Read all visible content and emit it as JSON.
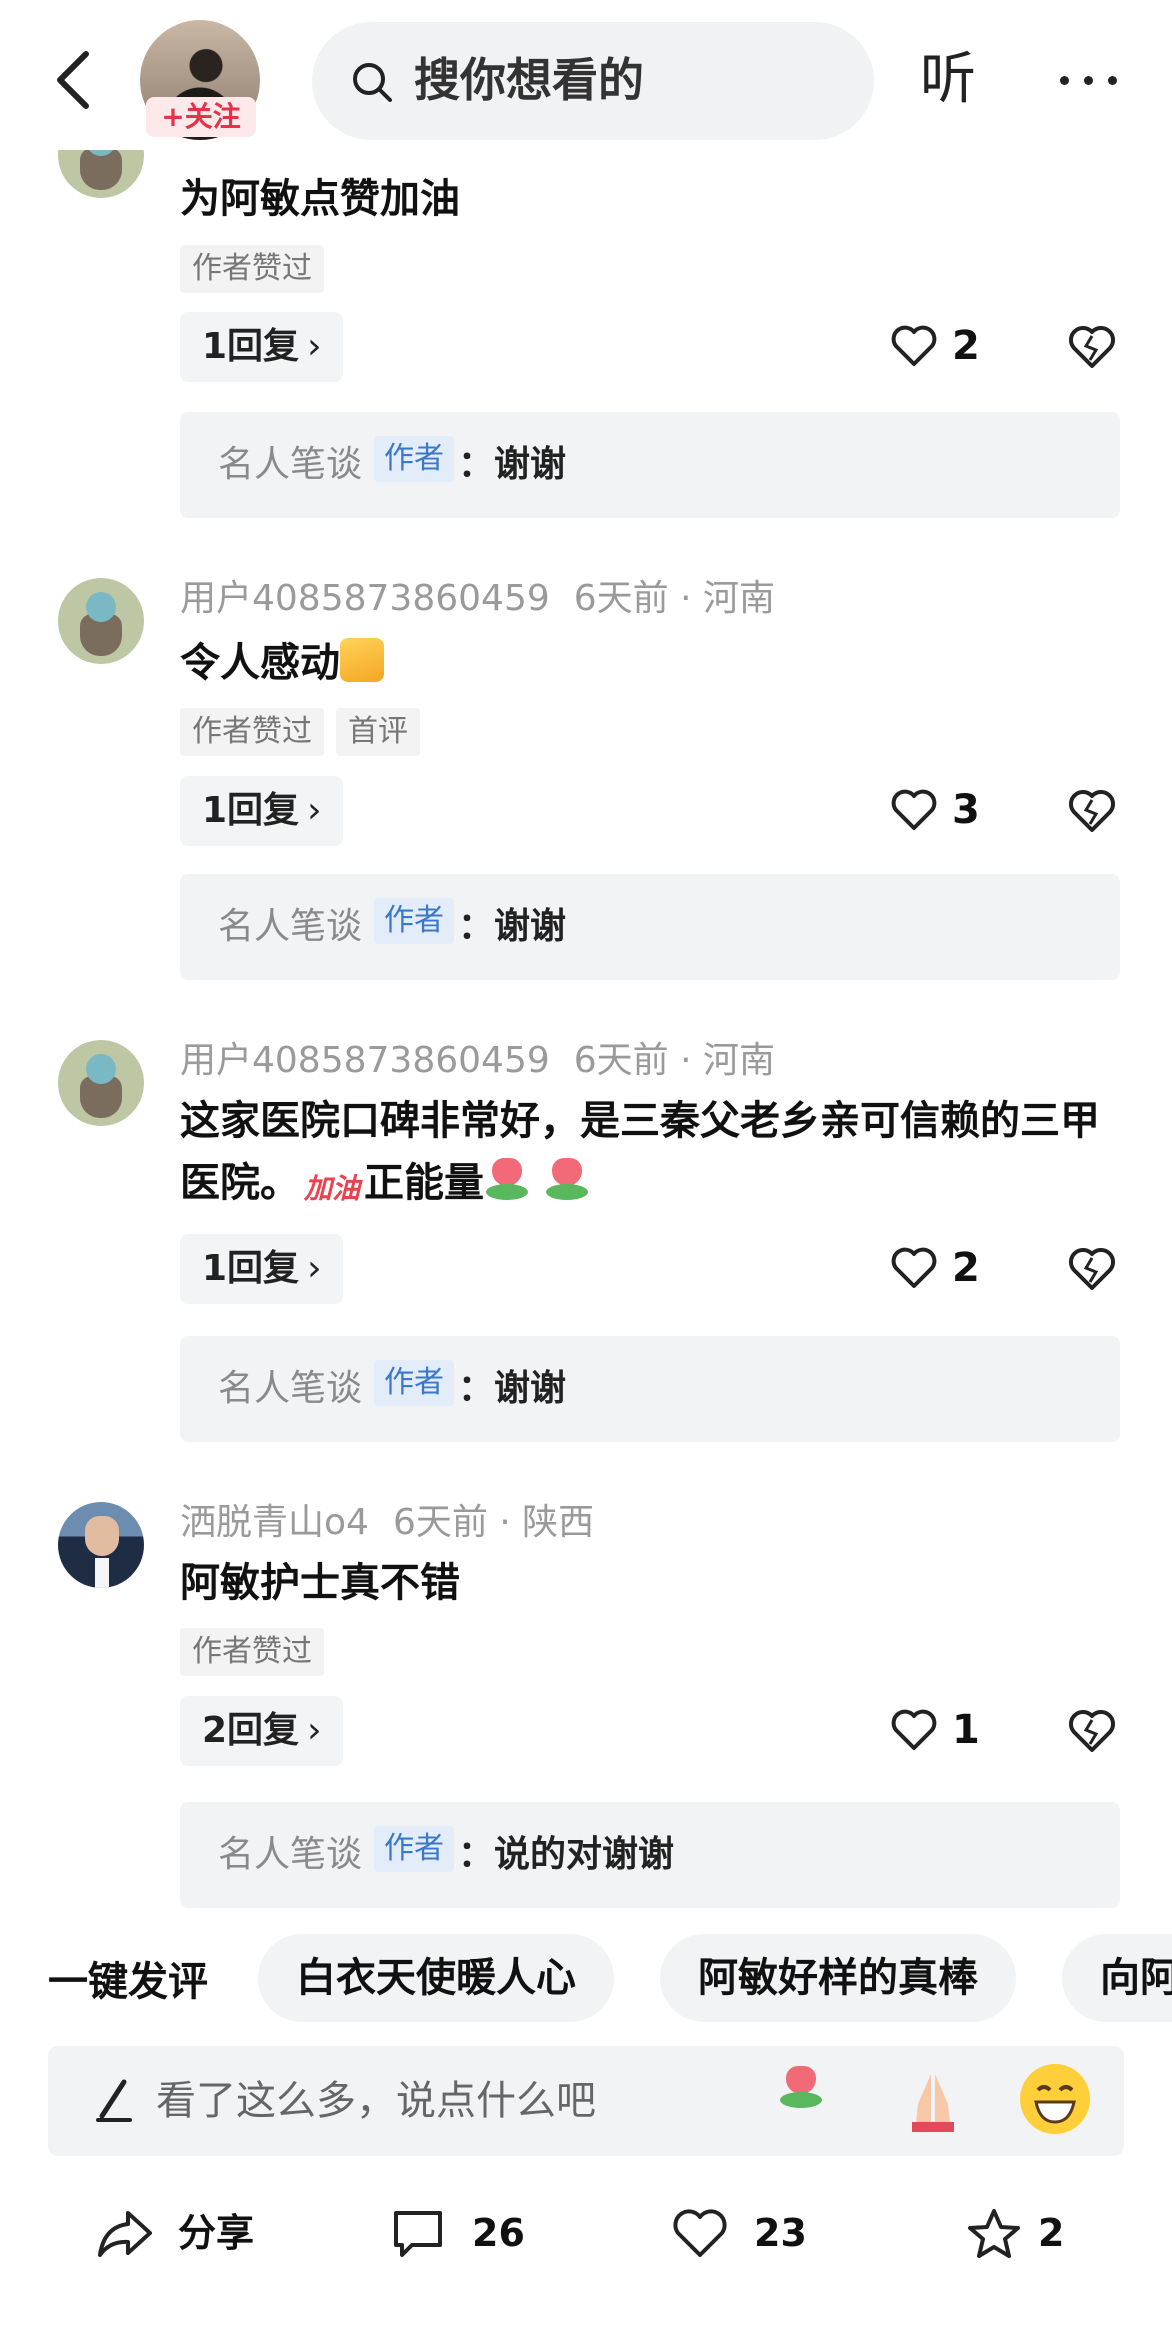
{
  "header": {
    "follow_label": "+关注",
    "search_placeholder": "搜你想看的",
    "listen_label": "听"
  },
  "comments": [
    {
      "user": "",
      "time": "",
      "location": "",
      "text": "为阿敏点赞加油",
      "tags": [
        "作者赞过"
      ],
      "reply_label": "1回复",
      "likes": "2",
      "author_reply": {
        "name": "名人笔谈",
        "badge": "作者",
        "text": "：谢谢"
      }
    },
    {
      "user": "用户4085873860459",
      "time": "6天前 · 河南",
      "text": "令人感动",
      "tags": [
        "作者赞过",
        "首评"
      ],
      "reply_label": "1回复",
      "likes": "3",
      "author_reply": {
        "name": "名人笔谈",
        "badge": "作者",
        "text": "：谢谢"
      }
    },
    {
      "user": "用户4085873860459",
      "time": "6天前 · 河南",
      "text": "这家医院口碑非常好，是三秦父老乡亲可信赖的三甲医院。",
      "emoji_text": "加油",
      "text_tail": "正能量",
      "reply_label": "1回复",
      "likes": "2",
      "author_reply": {
        "name": "名人笔谈",
        "badge": "作者",
        "text": "：谢谢"
      }
    },
    {
      "user": "洒脱青山o4",
      "time": "6天前 · 陕西",
      "text": "阿敏护士真不错",
      "tags": [
        "作者赞过"
      ],
      "reply_label": "2回复",
      "likes": "1",
      "author_reply": {
        "name": "名人笔谈",
        "badge": "作者",
        "text": "：说的对谢谢"
      }
    }
  ],
  "quick_comment": {
    "label": "一键发评",
    "chips": [
      "白衣天使暖人心",
      "阿敏好样的真棒",
      "向阿"
    ]
  },
  "input": {
    "placeholder": "看了这么多，说点什么吧"
  },
  "actions": {
    "share": "分享",
    "comments": "26",
    "likes": "23",
    "favorites": "2"
  }
}
